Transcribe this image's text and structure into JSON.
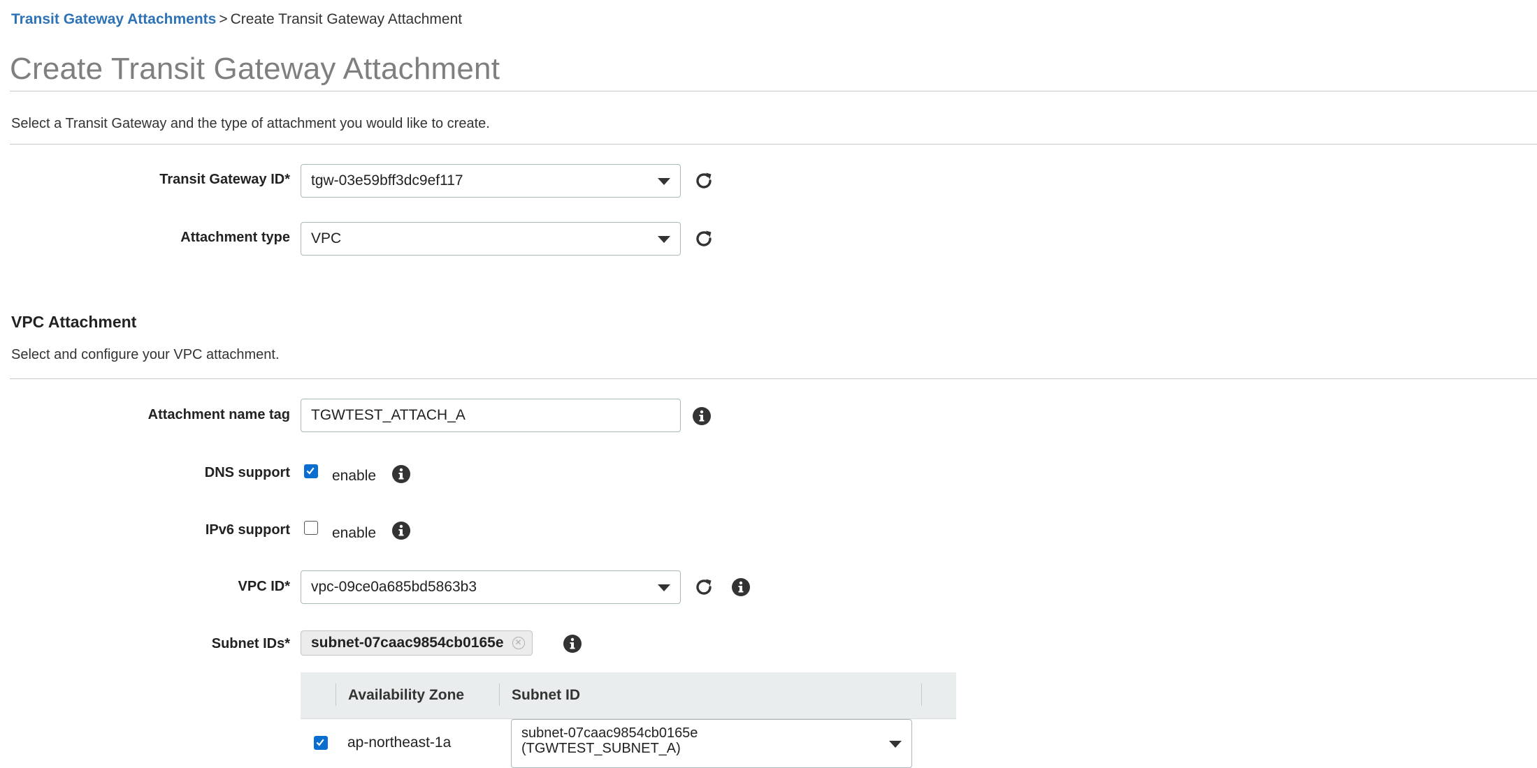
{
  "breadcrumb": {
    "parent": "Transit Gateway Attachments",
    "separator": ">",
    "current": "Create Transit Gateway Attachment"
  },
  "page_title": "Create Transit Gateway Attachment",
  "intro_text": "Select a Transit Gateway and the type of attachment you would like to create.",
  "fields": {
    "transit_gateway_id": {
      "label": "Transit Gateway ID*",
      "value": "tgw-03e59bff3dc9ef117"
    },
    "attachment_type": {
      "label": "Attachment type",
      "value": "VPC"
    }
  },
  "vpc_section": {
    "title": "VPC Attachment",
    "description": "Select and configure your VPC attachment.",
    "name_tag": {
      "label": "Attachment name tag",
      "value": "TGWTEST_ATTACH_A"
    },
    "dns_support": {
      "label": "DNS support",
      "checkbox_label": "enable",
      "checked": true
    },
    "ipv6_support": {
      "label": "IPv6 support",
      "checkbox_label": "enable",
      "checked": false
    },
    "vpc_id": {
      "label": "VPC ID*",
      "value": "vpc-09ce0a685bd5863b3"
    },
    "subnet_ids": {
      "label": "Subnet IDs*",
      "selected_token": "subnet-07caac9854cb0165e"
    },
    "subnet_table": {
      "columns": [
        "Availability Zone",
        "Subnet ID"
      ],
      "rows": [
        {
          "checked": true,
          "zone": "ap-northeast-1a",
          "subnet_line1": "subnet-07caac9854cb0165e",
          "subnet_line2": "(TGWTEST_SUBNET_A)"
        }
      ]
    }
  },
  "colors": {
    "link": "#2e73b8",
    "title_gray": "#7f7f7f",
    "checkbox_blue": "#0a6ed1",
    "table_header_bg": "#eaeded"
  }
}
